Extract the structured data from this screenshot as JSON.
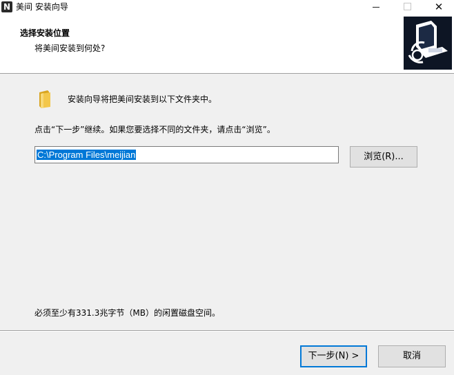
{
  "window": {
    "title": "美间 安装向导",
    "app_icon_glyph": "N",
    "minimize_icon": "minimize-icon",
    "maximize_icon": "maximize-icon",
    "close_icon": "close-icon",
    "close_glyph": "✕"
  },
  "header": {
    "title": "选择安装位置",
    "subtitle": "将美间安装到何处?"
  },
  "body": {
    "intro": "安装向导将把美间安装到以下文件夹中。",
    "instruction": "点击“下一步”继续。如果您要选择不同的文件夹，请点击“浏览”。",
    "install_path": "C:\\Program Files\\meijian",
    "browse_label": "浏览(R)...",
    "disk_space": "必须至少有331.3兆字节（MB）的闲置磁盘空间。"
  },
  "footer": {
    "next_label": "下一步(N) >",
    "cancel_label": "取消"
  },
  "colors": {
    "accent": "#0078d7",
    "folder": "#f3c74a"
  }
}
